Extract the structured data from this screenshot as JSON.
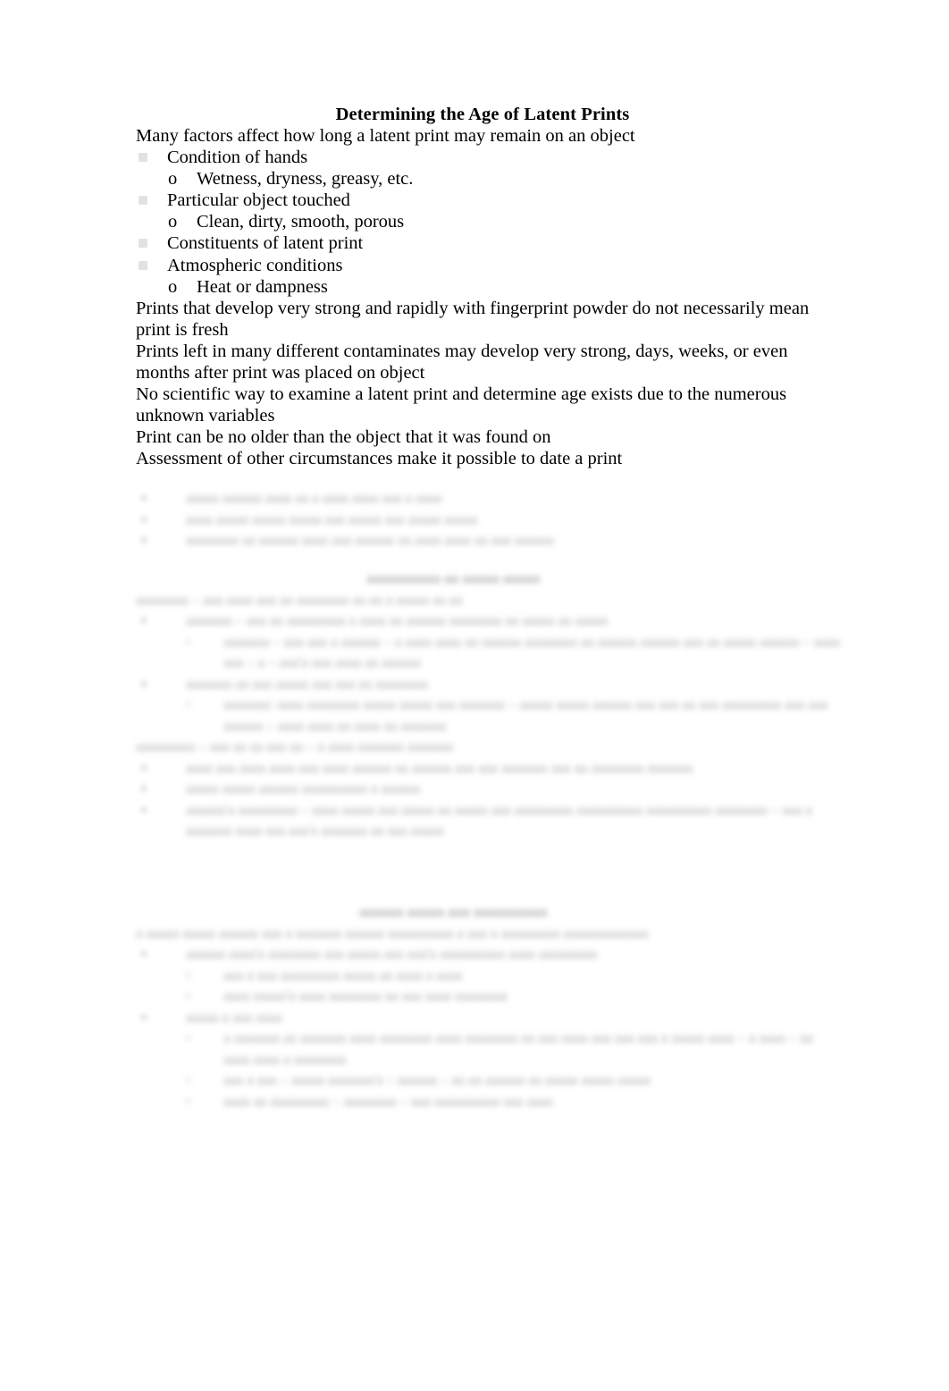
{
  "document": {
    "title": "Determining the Age of Latent Prints",
    "background_color": "#ffffff",
    "text_color": "#000000",
    "bullet_color": "#e2e2e2"
  },
  "intro": {
    "line": "Many factors affect how long a latent print may remain on an object"
  },
  "factors": [
    {
      "label": "Condition of hands",
      "sub_marker": "o",
      "sub": "Wetness, dryness, greasy, etc."
    },
    {
      "label": "Particular object touched",
      "sub_marker": "o",
      "sub": "Clean, dirty, smooth, porous"
    },
    {
      "label": "Constituents of latent print",
      "sub_marker": "",
      "sub": ""
    },
    {
      "label": "Atmospheric conditions",
      "sub_marker": "o",
      "sub": "Heat or dampness"
    }
  ],
  "statements": [
    "Prints that develop very strong and rapidly with fingerprint powder do not necessarily mean print is fresh",
    "Prints left in many different contaminates may develop very strong, days, weeks, or even months after print was placed on object",
    "No scientific way to examine a latent print and determine age exists due to the numerous unknown variables",
    "Print can be no older than the object that it was found on",
    "Assessment of other circumstances make it possible to date a print"
  ],
  "redacted": {
    "note": "illegible blurred text",
    "block_a": [
      {
        "type": "bullet",
        "marker": "▪",
        "text": "aaaaa aaaaaa aaaa aa a aaaa aaaa aaa a aaaa"
      },
      {
        "type": "bullet",
        "marker": "▪",
        "text": "aaaa aaaaa aaaaa aaaaa aaa aaaaa aaa aaaaa aaaaa"
      },
      {
        "type": "bullet",
        "marker": "▪",
        "text": "aaaaaaaa aa aaaaaa aaaa aaa aaaaaa aa aaaa aaaa aa aaa aaaaaa"
      }
    ],
    "heading_b": "aaaaaaaaaa aa aaaaa aaaaa",
    "block_b": [
      {
        "type": "para",
        "text": "aaaaaaaa – aaa aaaa aaa aa aaaaaaaa aa aa a aaaaa aa aa"
      },
      {
        "type": "bullet",
        "marker": "▪",
        "text": "aaaaaaa – aaa aa aaaaaaaaa a aaaa aa aaaaaa aaaaaaaa aa aaaaa aa aaaaa"
      },
      {
        "type": "subbullet",
        "marker": "▫",
        "text": "aaaaaaa – aaa aaa a aaaaaa – a aaaa aaaa aa aaaaaa aaaaaaaa aa aaaaaa aaaaaa aaa aa aaaaa aaaaaa – aaaa aaa – a – aaa'a aaa aaaa aa aaaaaa"
      },
      {
        "type": "bullet",
        "marker": "▪",
        "text": "aaaaaaa aa aaa aaaaa aaa aaa aa aaaaaaaa"
      },
      {
        "type": "subbullet",
        "marker": "▫",
        "text": "aaaaaaa: aaaa aaaaaaaa aaaaa aaaaa aaa aaaaaaa – aaaaa aaaaa aaaaaa aaa aaa aa aaa aaaaaaaaa aaa aaa aaaaaa – aaaa aaaa aa aaaa aa aaaaaaa"
      },
      {
        "type": "para",
        "text": "aaaaaaaaa – aaa aa aa aaa aa – a aaaa aaaaaaa aaaaaaa"
      },
      {
        "type": "bullet",
        "marker": "▪",
        "text": "aaaa aaa aaaa aaaa aaa aaaa aaaaaa aa aaaaaa aaa aaa aaaaaaa aaa aa aaaaaaaa aaaaaaa"
      },
      {
        "type": "bullet",
        "marker": "▪",
        "text": "aaaaa aaaaa aaaaaa aaaaaaaaaa a aaaaaa"
      },
      {
        "type": "bullet",
        "marker": "▪",
        "text": "aaaaaa'a aaaaaaaaa – aaaa aaaaa aaa aaaaa aa aaaaa aaa aaaaaaaaa aaaaaaaaaa aaaaaaaaaa aaaaaaaa – aaa a aaaaaaa aaaa aaa aaa'a aaaaaaa aa aaa aaaaa"
      }
    ],
    "heading_c": "aaaaaa aaaaa aaa aaaaaaaaaa",
    "block_c": [
      {
        "type": "para",
        "text": "a aaaaa aaaaa aaaaaa aaa a aaaaaaa aaaaaa aaaaaaaaaa a aaa a aaaaaaaaa aaaaaaaaaaaaa"
      },
      {
        "type": "bullet",
        "marker": "▪",
        "text": "aaaaaa aaaa'a aaaaaaaa aaa aaaaa aaa aaa'a aaaaaaaaaa aaaa aaaaaaaaa"
      },
      {
        "type": "subbullet",
        "marker": "▫",
        "text": "aaa a aaa aaaaaaaaa aaaaa aa aaaa a aaaa"
      },
      {
        "type": "subbullet",
        "marker": "▫",
        "text": "aaaa aaaaa'a aaaa aaaaaaaa aa aaa aaaa aaaaaaaa"
      },
      {
        "type": "bullet",
        "marker": "▪",
        "text": "aaaaa a aaa aaaa"
      },
      {
        "type": "subbullet",
        "marker": "▫",
        "text": "a aaaaaaa aa aaaaaaa aaaa aaaaaaaa aaaa aaaaaaaa aa aaa aaaa aaa aaa aaa a aaaaa aaaa – a aaaa – aa aaaa aaaa a aaaaaaaa"
      },
      {
        "type": "subbullet",
        "marker": "▫",
        "text": "aaa a aaa – aaaaa aaaaaaa'a – aaaaaa – aa aa aaaaaa aa aaaaa aaaaa aaaaa"
      },
      {
        "type": "subbullet",
        "marker": "▫",
        "text": "aaaa aa aaaaaaaaa – aaaaaaaa – aaa aaaaaaaaaa aaa aaaa"
      }
    ]
  }
}
